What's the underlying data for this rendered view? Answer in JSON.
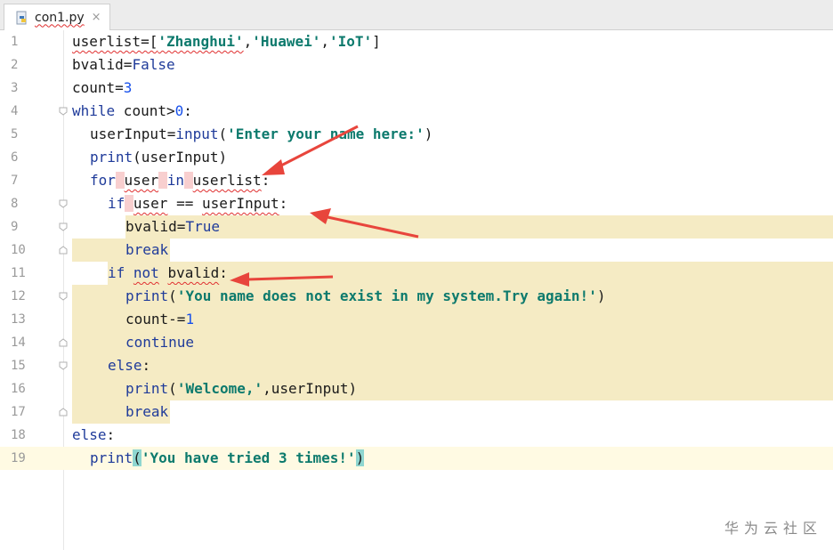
{
  "tab": {
    "filename": "con1.py",
    "close": "×",
    "icon": "python-file-icon"
  },
  "lines": [
    {
      "n": "1"
    },
    {
      "n": "2"
    },
    {
      "n": "3"
    },
    {
      "n": "4"
    },
    {
      "n": "5"
    },
    {
      "n": "6"
    },
    {
      "n": "7"
    },
    {
      "n": "8"
    },
    {
      "n": "9"
    },
    {
      "n": "10"
    },
    {
      "n": "11"
    },
    {
      "n": "12"
    },
    {
      "n": "13"
    },
    {
      "n": "14"
    },
    {
      "n": "15"
    },
    {
      "n": "16"
    },
    {
      "n": "17"
    },
    {
      "n": "18"
    },
    {
      "n": "19"
    }
  ],
  "code": {
    "l1": {
      "a": "userlist=[",
      "s1": "'Zhanghui'",
      "c1": ",",
      "s2": "'Huawei'",
      "c2": ",",
      "s3": "'IoT'",
      "e": "]"
    },
    "l2": {
      "a": "bvalid=",
      "b": "False"
    },
    "l3": {
      "a": "count=",
      "b": "3"
    },
    "l4": {
      "k": "while",
      "a": " count>",
      "b": "0",
      "c": ":"
    },
    "l5": {
      "a": "userInput=",
      "b": "input",
      "c": "(",
      "s": "'Enter your name here:'",
      "d": ")"
    },
    "l6": {
      "b": "print",
      "a": "(userInput)"
    },
    "l7": {
      "k": "for",
      "sp1": " ",
      "v1": "user",
      "sp2": " ",
      "k2": "in",
      "sp3": " ",
      "v2": "userlist",
      "e": ":"
    },
    "l8": {
      "k": "if",
      "sp1": " ",
      "v1": "user",
      "a": " == ",
      "v2": "userInput",
      "e": ":"
    },
    "l9": {
      "a": "bvalid=",
      "b": "True"
    },
    "l10": {
      "k": "break"
    },
    "l11": {
      "k": "if",
      "sp": " ",
      "k2": "not",
      "sp2": " ",
      "v": "bvalid",
      "e": ":"
    },
    "l12": {
      "b": "print",
      "a": "(",
      "s": "'You name does not exist in my system.Try again!'",
      "e": ")"
    },
    "l13": {
      "a": "count-=",
      "b": "1"
    },
    "l14": {
      "k": "continue"
    },
    "l15": {
      "k": "else",
      "e": ":"
    },
    "l16": {
      "b": "print",
      "a": "(",
      "s": "'Welcome,'",
      "c": ",userInput)"
    },
    "l17": {
      "k": "break"
    },
    "l18": {
      "k": "else",
      "e": ":"
    },
    "l19": {
      "b": "print",
      "p1": "(",
      "s": "'You have tried 3 times!'",
      "p2": ")"
    }
  },
  "colors": {
    "arrow": "#e8453c",
    "highlight": "#f5ebc4",
    "caret_line": "#fffae3"
  },
  "watermark": "华为云社区"
}
